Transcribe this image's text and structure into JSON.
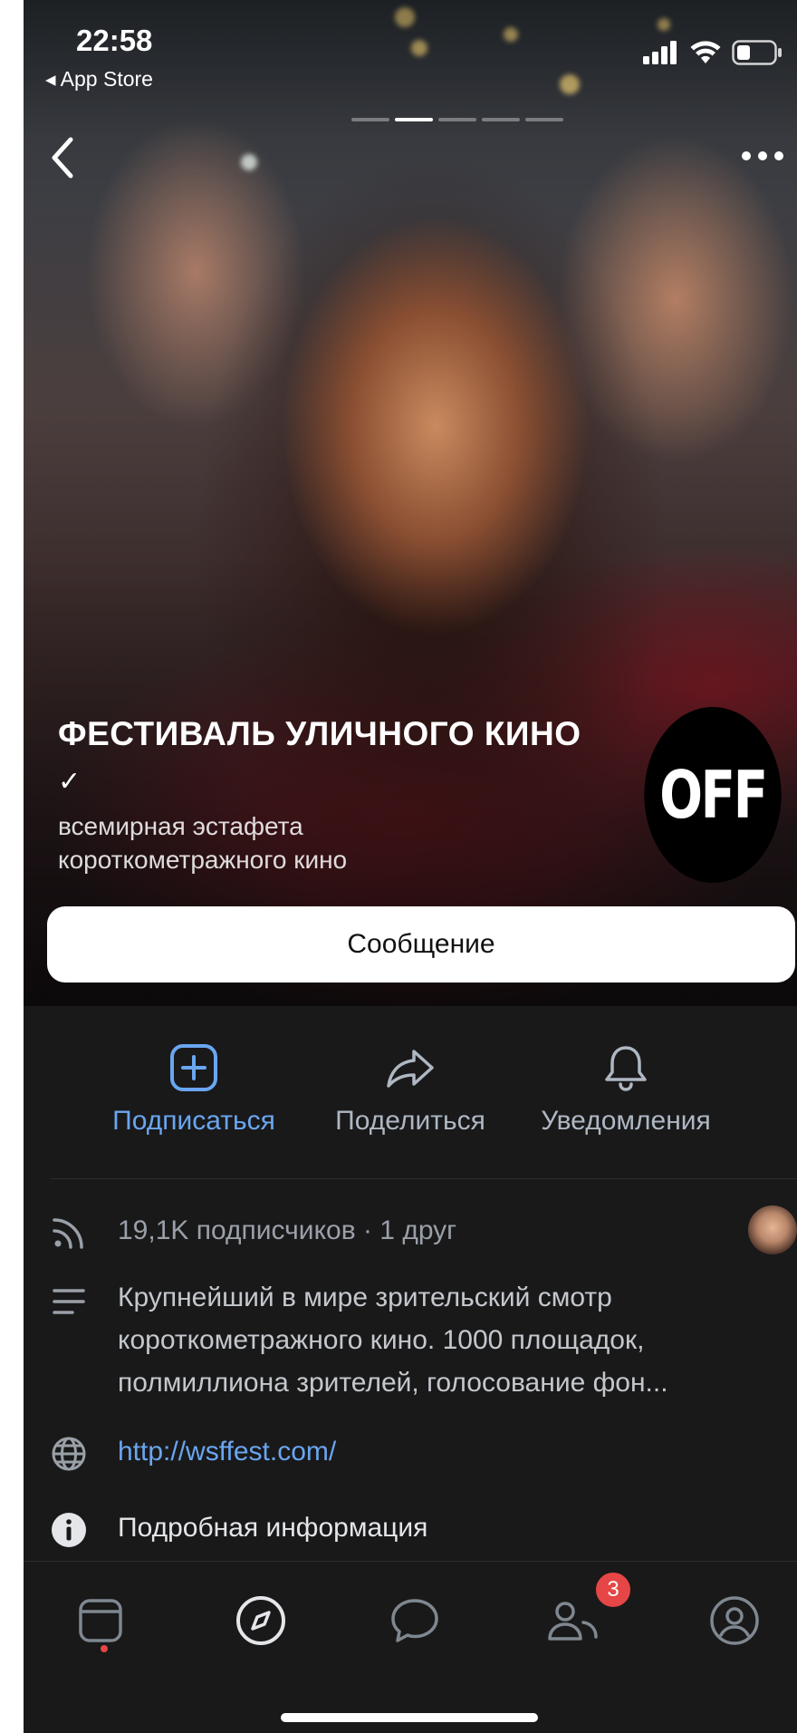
{
  "status_bar": {
    "time": "22:58",
    "back_app": "◂ App Store"
  },
  "community": {
    "title": "ФЕСТИВАЛЬ УЛИЧНОГО КИНО",
    "verified_mark": "✓",
    "subtitle": "всемирная эстафета короткометражного кино",
    "logo_text": "OFF",
    "message_button": "Сообщение"
  },
  "photo_pager": {
    "count": 5,
    "active": 1
  },
  "actions": [
    {
      "label": "Подписаться",
      "icon": "plus-square-icon",
      "active": true
    },
    {
      "label": "Поделиться",
      "icon": "share-arrow-icon",
      "active": false
    },
    {
      "label": "Уведомления",
      "icon": "bell-icon",
      "active": false
    }
  ],
  "info": {
    "subscribers": "19,1K подписчиков · 1 друг",
    "description": "Крупнейший в мире зрительский смотр короткометражного кино. 1000 площадок, полмиллиона зрителей, голосование фон...",
    "website": "http://wsffest.com/",
    "details": "Подробная информация"
  },
  "tabbar": {
    "tabs": [
      "feed-icon",
      "discover-compass-icon",
      "messages-icon",
      "friends-icon",
      "profile-icon"
    ],
    "friends_badge": "3"
  },
  "colors": {
    "accent": "#6aa6f0",
    "background": "#19191a",
    "badge": "#e64646"
  }
}
